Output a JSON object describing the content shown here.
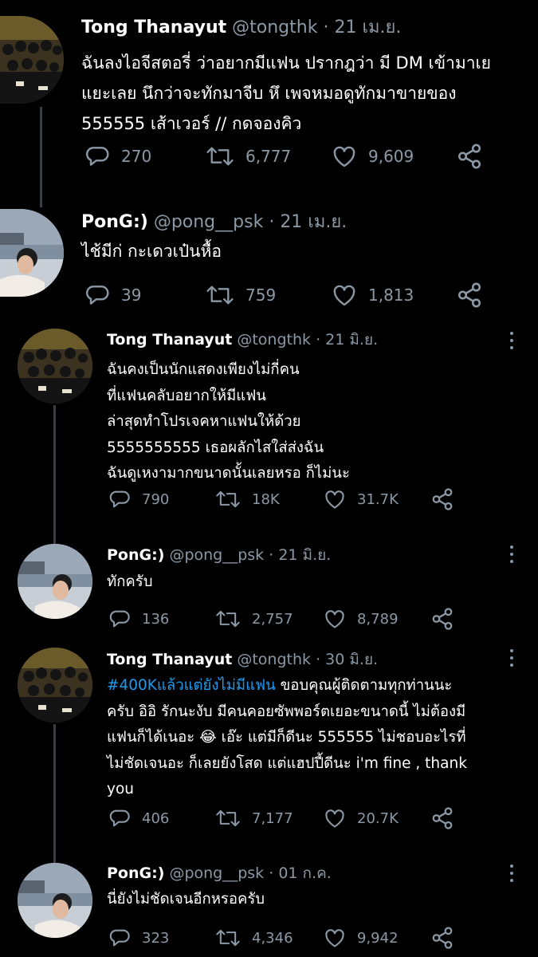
{
  "colors": {
    "background": "#000000",
    "text": "#ffffff",
    "secondary": "#8b98a5",
    "hashtag": "#1d9bf0",
    "thread_line": "#3a3d41"
  },
  "icons": {
    "reply": "reply-icon",
    "retweet": "retweet-icon",
    "like": "heart-icon",
    "share": "share-icon",
    "more": "more-options-icon"
  },
  "tweets": [
    {
      "name": "Tong Thanayut",
      "handle": "@tongthk",
      "separator": "·",
      "date": "21 เม.ย.",
      "lines": [
        "ฉันลงไอจีสตอรี่ ว่าอยากมีแฟน ปรากฎว่า มี DM เข้ามาเย",
        "แยะเลย นึกว่าจะทักมาจีบ หึ เพจหมอดูทักมาขายของ",
        "555555 เส้าเวอร์ // กดจองคิว"
      ],
      "replies": "270",
      "retweets": "6,777",
      "likes": "9,609"
    },
    {
      "name": "PonG:)",
      "handle": "@pong__psk",
      "separator": "·",
      "date": "21 เม.ย.",
      "lines": [
        "ไช้มีก่ กะเดวเป๋นหื้อ"
      ],
      "replies": "39",
      "retweets": "759",
      "likes": "1,813"
    },
    {
      "name": "Tong Thanayut",
      "handle": "@tongthk",
      "separator": "·",
      "date": "21 มิ.ย.",
      "lines": [
        "ฉันคงเป็นนักแสดงเพียงไม่กี่คน",
        "ที่แฟนคลับอยากให้มีแฟน",
        "ล่าสุดทำโปรเจคหาแฟนให้ด้วย",
        "5555555555 เธอผลักไสใส่ส่งฉัน",
        "ฉันดูเหงามากขนาดนั้นเลยหรอ ก็ไม่นะ"
      ],
      "replies": "790",
      "retweets": "18K",
      "likes": "31.7K"
    },
    {
      "name": "PonG:)",
      "handle": "@pong__psk",
      "separator": "·",
      "date": "21 มิ.ย.",
      "lines": [
        "ทักครับ"
      ],
      "replies": "136",
      "retweets": "2,757",
      "likes": "8,789"
    },
    {
      "name": "Tong Thanayut",
      "handle": "@tongthk",
      "separator": "·",
      "date": "30 มิ.ย.",
      "hashtag": "#400Kแล้วแต่ยังไม่มีแฟน",
      "first_line_rest": " ขอบคุณผู้ติดตามทุกท่านนะ",
      "lines": [
        "ครับ อิอิ รักนะงับ มีคนคอยซัพพอร์ตเยอะขนาดนี้ ไม่ต้องมี",
        "แฟนก็ได้เนอะ 😂 เอ๊ะ แต่มีก็ดีนะ  555555 ไม่ชอบอะไรที่",
        "ไม่ชัดเจนอะ ก็เลยยังโสด  แต่แฮปปี้ดีนะ i'm fine , thank",
        "you"
      ],
      "replies": "406",
      "retweets": "7,177",
      "likes": "20.7K"
    },
    {
      "name": "PonG:)",
      "handle": "@pong__psk",
      "separator": "·",
      "date": "01 ก.ค.",
      "lines": [
        "นี่ยังไม่ชัดเจนอีกหรอครับ"
      ],
      "replies": "323",
      "retweets": "4,346",
      "likes": "9,942"
    }
  ]
}
